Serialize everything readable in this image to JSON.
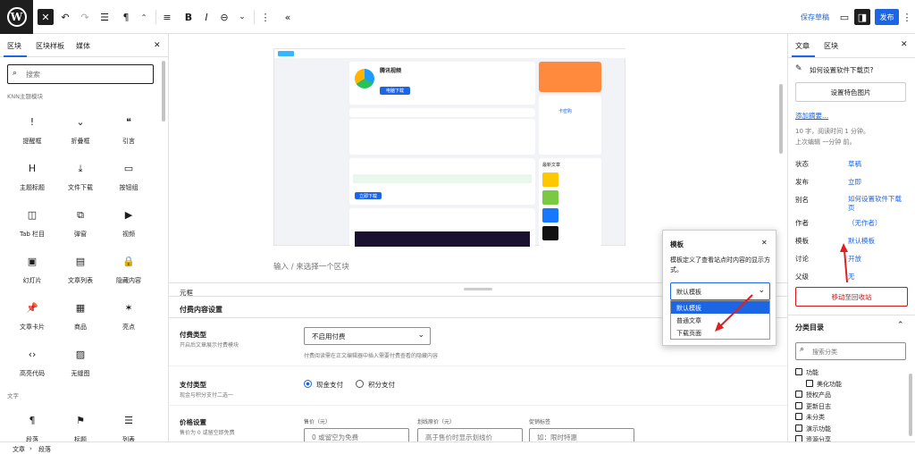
{
  "toolbar": {
    "save_draft": "保存草稿",
    "publish": "发布"
  },
  "left_panel": {
    "tabs": [
      "区块",
      "区块样板",
      "媒体"
    ],
    "search_placeholder": "搜索",
    "category1": "KNN主题模块",
    "blocks": [
      {
        "label": "提醒框",
        "icon": "!"
      },
      {
        "label": "折叠框",
        "icon": "⌄"
      },
      {
        "label": "引言",
        "icon": "❝"
      },
      {
        "label": "主题标题",
        "icon": "H"
      },
      {
        "label": "文件下载",
        "icon": "⤓"
      },
      {
        "label": "按钮组",
        "icon": "▭"
      },
      {
        "label": "Tab 栏目",
        "icon": "◫"
      },
      {
        "label": "弹窗",
        "icon": "⧉"
      },
      {
        "label": "视频",
        "icon": "▶"
      },
      {
        "label": "幻灯片",
        "icon": "▣"
      },
      {
        "label": "文章列表",
        "icon": "▤"
      },
      {
        "label": "隐藏内容",
        "icon": "🔒"
      },
      {
        "label": "文章卡片",
        "icon": "📌"
      },
      {
        "label": "商品",
        "icon": "▦"
      },
      {
        "label": "亮点",
        "icon": "✶"
      },
      {
        "label": "高亮代码",
        "icon": "‹›"
      },
      {
        "label": "无缝图",
        "icon": "▨"
      }
    ],
    "category2": "文字",
    "text_blocks": [
      {
        "label": "段落",
        "icon": "¶"
      },
      {
        "label": "标题",
        "icon": "⚑"
      },
      {
        "label": "列表",
        "icon": "☰"
      }
    ]
  },
  "preview": {
    "app_name": "腾讯视频",
    "download_btn": "电脑下载",
    "download_btn2": "立即下载",
    "brand_tag": "卡密购",
    "recommend": "最新文章"
  },
  "canvas": {
    "placeholder": "输入 / 来选择一个区块"
  },
  "metabox": {
    "title": "元框",
    "section": "付费内容设置",
    "pay_type_label": "付费类型",
    "pay_type_sub": "开启后文章展示付费模块",
    "pay_type_value": "不启用付费",
    "pay_type_hint": "付费阅读需在正文编辑器中插入需要付费查看的隐藏内容",
    "payment_label": "支付类型",
    "payment_sub": "现金与积分支付二选一",
    "payment_options": [
      "现金支付",
      "积分支付"
    ],
    "price_label": "价格设置",
    "price_sub": "售价为 0 或留空即免费",
    "price_fields": [
      {
        "label": "售价（元）",
        "placeholder": "0 或留空为免费"
      },
      {
        "label": "划线原价（元）",
        "placeholder": "高于售价时显示划线价"
      },
      {
        "label": "促销标签",
        "placeholder": "如：限时特惠"
      }
    ]
  },
  "template_popup": {
    "title": "模板",
    "desc": "模板定义了查看站点时内容的显示方式。",
    "selected": "默认模板",
    "options": [
      "默认模板",
      "普通文章",
      "下载页面"
    ]
  },
  "right_panel": {
    "tabs": [
      "文章",
      "区块"
    ],
    "post_title": "如何设置软件下载页?",
    "featured_btn": "设置特色图片",
    "excerpt_link": "添加摘要...",
    "stats1": "10 字，阅读时间 1 分钟。",
    "stats2": "上次编辑 一分钟 前。",
    "rows": [
      {
        "label": "状态",
        "value": "草稿"
      },
      {
        "label": "发布",
        "value": "立即"
      },
      {
        "label": "别名",
        "value": "如何设置软件下载页"
      },
      {
        "label": "作者",
        "value": "（无作者）"
      },
      {
        "label": "模板",
        "value": "默认模板"
      },
      {
        "label": "讨论",
        "value": "开放"
      },
      {
        "label": "父级",
        "value": "无"
      }
    ],
    "trash_btn": "移动至回收站",
    "cat_title": "分类目录",
    "cat_search": "搜索分类",
    "categories": [
      "功能",
      "美化功能",
      "授权产品",
      "更新日志",
      "未分类",
      "演示功能",
      "资源分享"
    ]
  },
  "breadcrumb": [
    "文章",
    "段落"
  ],
  "colors": {
    "accent": "#1c66e5",
    "danger": "#cc1818",
    "arrow": "#e02020"
  }
}
